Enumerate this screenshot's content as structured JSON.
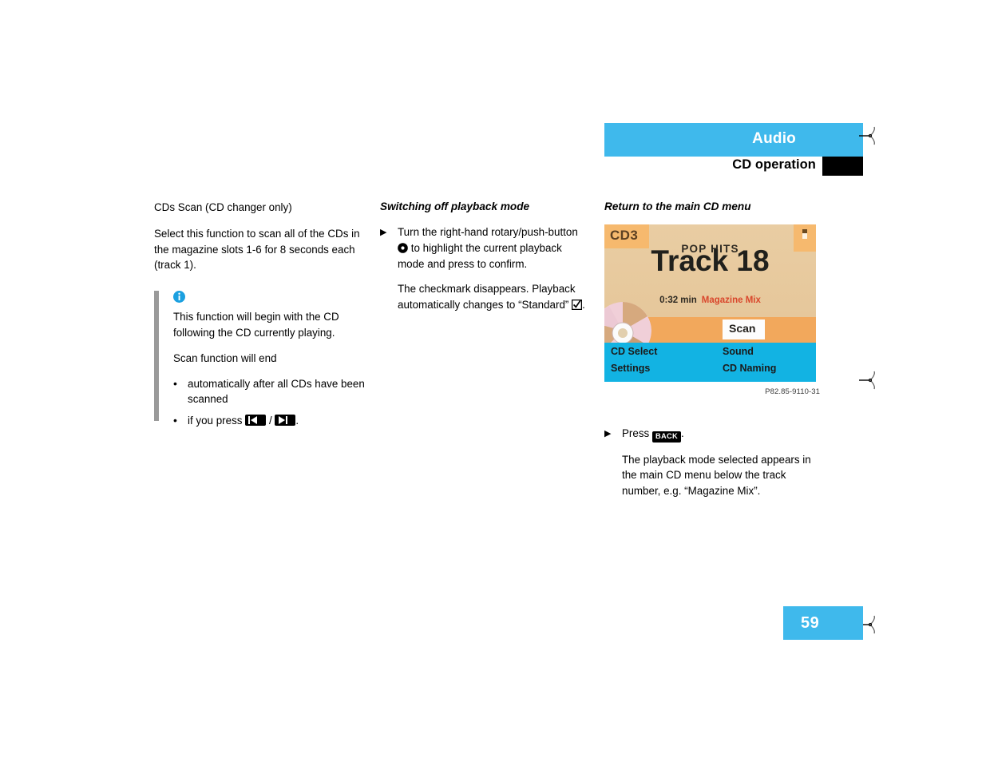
{
  "header": {
    "title": "Audio",
    "subtitle": "CD operation",
    "band_color": "#3fb9ec",
    "marker_color": "#000000"
  },
  "columns": {
    "left": {
      "heading": "CDs Scan (CD changer only)",
      "intro": "Select this function to scan all of the CDs in the magazine slots 1-6 for 8 seconds each (track 1).",
      "note": {
        "icon_name": "info-icon",
        "paragraph1": "This function will begin with the CD following the CD currently playing.",
        "paragraph2": "Scan function will end",
        "bullets": [
          {
            "marker": "•",
            "text": "automatically after all CDs have been scanned"
          }
        ],
        "bullet_press": {
          "marker": "•",
          "prefix": "if you press",
          "separator": "/",
          "suffix": ".",
          "key1_name": "skip-back-key",
          "key2_name": "skip-forward-key"
        }
      }
    },
    "middle": {
      "heading": "Switching off playback mode",
      "step": {
        "marker": "▶",
        "text_before_glyph": "Turn the right-hand rotary/push-button",
        "glyph_name": "rotary-push-button-icon",
        "text_after_glyph": "to highlight the current playback mode and press to confirm.",
        "result_before_glyph": "The checkmark disappears. Playback automatically changes to “Standard”",
        "result_glyph_name": "checkmark-box-icon",
        "result_after_glyph": "."
      }
    },
    "right": {
      "heading": "Return to the main CD menu",
      "figure_caption": "P82.85-9110-31",
      "step": {
        "marker": "▶",
        "press_label": "Press",
        "key_label": "BACK",
        "period": ".",
        "result": "The playback mode selected appears in the main CD menu below the track number, e.g. “Magazine Mix”."
      }
    }
  },
  "cd_display": {
    "disc_badge": "CD3",
    "album": "POP HITS",
    "track": "Track 18",
    "time": "0:32 min",
    "mode": "Magazine Mix",
    "scan_chip": "Scan",
    "menu": {
      "cd_select": "CD Select",
      "settings": "Settings",
      "sound": "Sound",
      "cd_naming": "CD Naming"
    },
    "colors": {
      "background": "#e7c99d",
      "orange_strip": "#f2a85c",
      "bottom_bar": "#12b3e3",
      "badge": "#f6b96e",
      "mode_text": "#d9472c"
    },
    "corner_icon_name": "cd-slot-indicator-icon",
    "disc_icon_name": "compact-disc-icon"
  },
  "footer": {
    "page_number": "59"
  }
}
